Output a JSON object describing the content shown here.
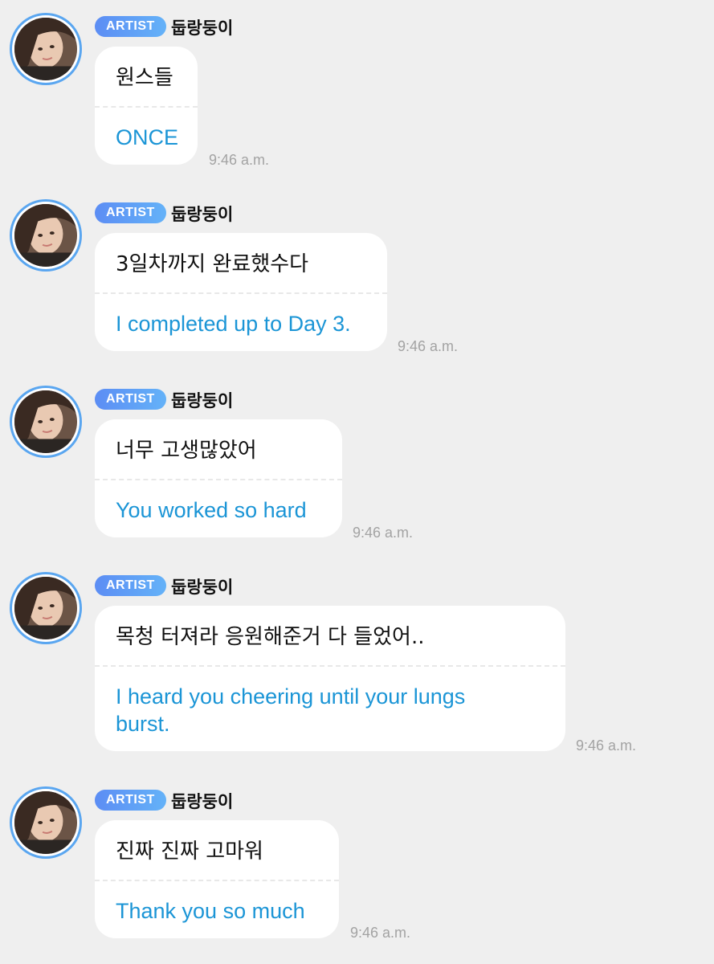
{
  "colors": {
    "background": "#efefef",
    "badge": "#5c8df4",
    "avatar_ring": "#5aa6f0",
    "translation": "#1b95d6"
  },
  "messages": [
    {
      "badge": "ARTIST",
      "sender": "둡랑둥이",
      "text": "원스들",
      "translation": "ONCE",
      "time": "9:46 a.m."
    },
    {
      "badge": "ARTIST",
      "sender": "둡랑둥이",
      "text": "3일차까지 완료했수다",
      "translation": "I completed up to Day 3.",
      "time": "9:46 a.m."
    },
    {
      "badge": "ARTIST",
      "sender": "둡랑둥이",
      "text": "너무 고생많았어",
      "translation": "You worked so hard",
      "time": "9:46 a.m."
    },
    {
      "badge": "ARTIST",
      "sender": "둡랑둥이",
      "text": "목청 터져라 응원해준거 다 들었어..",
      "translation": "I heard you cheering until your lungs burst.",
      "time": "9:46 a.m."
    },
    {
      "badge": "ARTIST",
      "sender": "둡랑둥이",
      "text": "진짜 진짜 고마워",
      "translation": "Thank you so much",
      "time": "9:46 a.m."
    }
  ]
}
